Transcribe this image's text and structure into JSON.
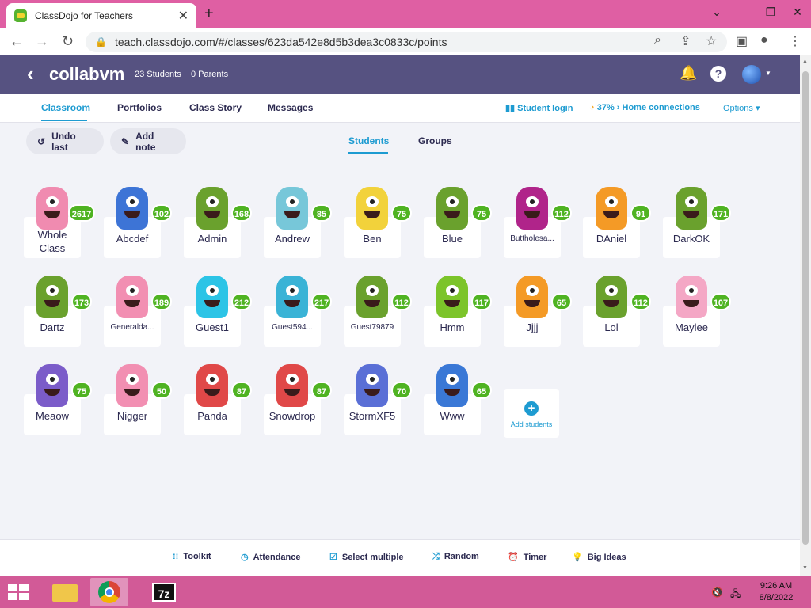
{
  "browser": {
    "tab_title": "ClassDojo for Teachers",
    "tab_close": "✕",
    "new_tab": "+",
    "url": "teach.classdojo.com/#/classes/623da542e8d5b3dea3c0833c/points",
    "window_buttons": [
      "⌄",
      "—",
      "❐",
      "✕"
    ]
  },
  "header": {
    "class_name": "collabvm",
    "students_count": "23 Students",
    "parents_count": "0 Parents"
  },
  "nav": {
    "tabs": [
      "Classroom",
      "Portfolios",
      "Class Story",
      "Messages"
    ],
    "student_login": "Student login",
    "home_connections": "37% › Home connections",
    "options": "Options ▾"
  },
  "toolbar": {
    "undo": "Undo last",
    "add_note": "Add note",
    "view_students": "Students",
    "view_groups": "Groups"
  },
  "students": [
    {
      "name": "Whole Class",
      "points": "2617",
      "color": "#f08bb0"
    },
    {
      "name": "Abcdef",
      "points": "102",
      "color": "#3d74d6"
    },
    {
      "name": "Admin",
      "points": "168",
      "color": "#6aa12d"
    },
    {
      "name": "Andrew",
      "points": "85",
      "color": "#77c7d9"
    },
    {
      "name": "Ben",
      "points": "75",
      "color": "#f2d23b"
    },
    {
      "name": "Blue",
      "points": "75",
      "color": "#6aa12d"
    },
    {
      "name": "Buttholesa...",
      "points": "112",
      "color": "#b0248a"
    },
    {
      "name": "DAniel",
      "points": "91",
      "color": "#f49a26"
    },
    {
      "name": "DarkOK",
      "points": "171",
      "color": "#6aa12d"
    },
    {
      "name": "Dartz",
      "points": "173",
      "color": "#6aa12d"
    },
    {
      "name": "Generalda...",
      "points": "189",
      "color": "#f28fb2"
    },
    {
      "name": "Guest1",
      "points": "212",
      "color": "#2cc4e6"
    },
    {
      "name": "Guest594...",
      "points": "217",
      "color": "#3ab3d6"
    },
    {
      "name": "Guest79879",
      "points": "112",
      "color": "#6aa12d"
    },
    {
      "name": "Hmm",
      "points": "117",
      "color": "#7cc42a"
    },
    {
      "name": "Jjjj",
      "points": "65",
      "color": "#f49a26"
    },
    {
      "name": "Lol",
      "points": "112",
      "color": "#6aa12d"
    },
    {
      "name": "Maylee",
      "points": "107",
      "color": "#f4a7c5"
    },
    {
      "name": "Meaow",
      "points": "75",
      "color": "#7b5cc9"
    },
    {
      "name": "Nigger",
      "points": "50",
      "color": "#f28fb2"
    },
    {
      "name": "Panda",
      "points": "87",
      "color": "#e04848"
    },
    {
      "name": "Snowdrop",
      "points": "87",
      "color": "#e04848"
    },
    {
      "name": "StormXF5",
      "points": "70",
      "color": "#5a6fd6"
    },
    {
      "name": "Www",
      "points": "65",
      "color": "#3a78d6"
    }
  ],
  "add_students": "Add students",
  "bottom_bar": {
    "toolkit": "Toolkit",
    "attendance": "Attendance",
    "select_multiple": "Select multiple",
    "random": "Random",
    "timer": "Timer",
    "big_ideas": "Big Ideas"
  },
  "taskbar": {
    "time": "9:26 AM",
    "date": "8/8/2022",
    "app_7z": "7z"
  }
}
